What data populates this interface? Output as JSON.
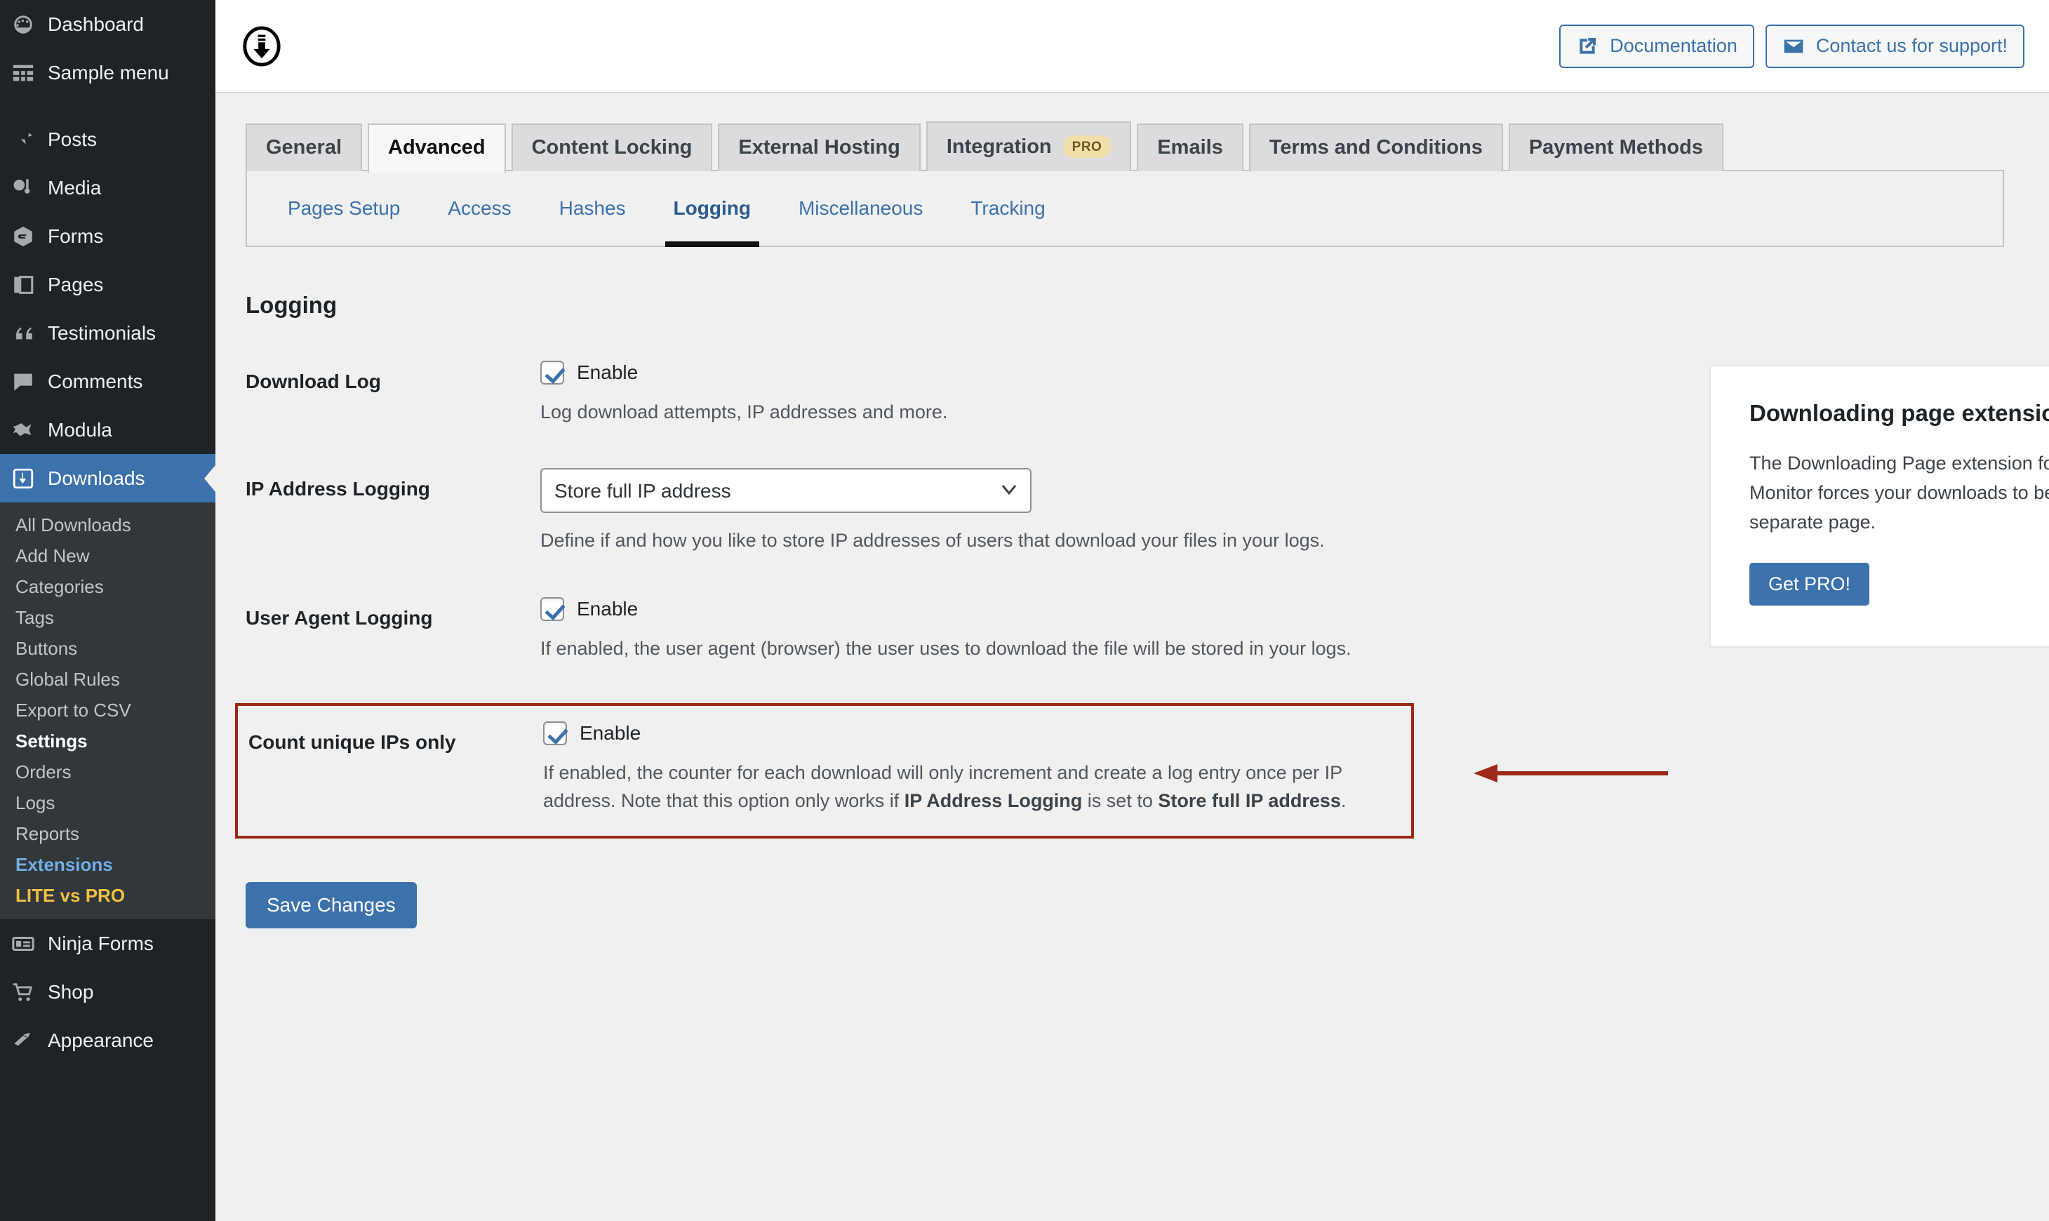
{
  "sidebar": {
    "top_items": [
      {
        "label": "Dashboard",
        "icon": "dashboard-icon"
      },
      {
        "label": "Sample menu",
        "icon": "grid-icon"
      }
    ],
    "main_items": [
      {
        "label": "Posts",
        "icon": "pin-icon"
      },
      {
        "label": "Media",
        "icon": "media-icon"
      },
      {
        "label": "Forms",
        "icon": "forms-icon"
      },
      {
        "label": "Pages",
        "icon": "pages-icon"
      },
      {
        "label": "Testimonials",
        "icon": "quote-icon"
      },
      {
        "label": "Comments",
        "icon": "comment-icon"
      },
      {
        "label": "Modula",
        "icon": "modula-icon"
      }
    ],
    "active_item": {
      "label": "Downloads",
      "icon": "download-circle-icon"
    },
    "submenu": [
      {
        "label": "All Downloads",
        "state": "normal"
      },
      {
        "label": "Add New",
        "state": "normal"
      },
      {
        "label": "Categories",
        "state": "normal"
      },
      {
        "label": "Tags",
        "state": "normal"
      },
      {
        "label": "Buttons",
        "state": "normal"
      },
      {
        "label": "Global Rules",
        "state": "normal"
      },
      {
        "label": "Export to CSV",
        "state": "normal"
      },
      {
        "label": "Settings",
        "state": "current"
      },
      {
        "label": "Orders",
        "state": "normal"
      },
      {
        "label": "Logs",
        "state": "normal"
      },
      {
        "label": "Reports",
        "state": "normal"
      },
      {
        "label": "Extensions",
        "state": "blue"
      },
      {
        "label": "LITE vs PRO",
        "state": "gold"
      }
    ],
    "bottom_items": [
      {
        "label": "Ninja Forms",
        "icon": "ninja-forms-icon"
      },
      {
        "label": "Shop",
        "icon": "cart-icon"
      },
      {
        "label": "Appearance",
        "icon": "brush-icon"
      }
    ]
  },
  "header": {
    "logo_icon": "download-monitor-logo-icon",
    "documentation_label": "Documentation",
    "documentation_icon": "external-link-icon",
    "support_label": "Contact us for support!",
    "support_icon": "envelope-icon"
  },
  "main_tabs": [
    {
      "label": "General",
      "active": false,
      "badge": ""
    },
    {
      "label": "Advanced",
      "active": true,
      "badge": ""
    },
    {
      "label": "Content Locking",
      "active": false,
      "badge": ""
    },
    {
      "label": "External Hosting",
      "active": false,
      "badge": ""
    },
    {
      "label": "Integration",
      "active": false,
      "badge": "PRO"
    },
    {
      "label": "Emails",
      "active": false,
      "badge": ""
    },
    {
      "label": "Terms and Conditions",
      "active": false,
      "badge": ""
    },
    {
      "label": "Payment Methods",
      "active": false,
      "badge": ""
    }
  ],
  "sub_tabs": [
    {
      "label": "Pages Setup",
      "active": false
    },
    {
      "label": "Access",
      "active": false
    },
    {
      "label": "Hashes",
      "active": false
    },
    {
      "label": "Logging",
      "active": true
    },
    {
      "label": "Miscellaneous",
      "active": false
    },
    {
      "label": "Tracking",
      "active": false
    }
  ],
  "form": {
    "section_title": "Logging",
    "download_log": {
      "label": "Download Log",
      "checkbox_label": "Enable",
      "checked": true,
      "description": "Log download attempts, IP addresses and more."
    },
    "ip_logging": {
      "label": "IP Address Logging",
      "selected": "Store full IP address",
      "options": [
        "Store full IP address"
      ],
      "description": "Define if and how you like to store IP addresses of users that download your files in your logs."
    },
    "user_agent_logging": {
      "label": "User Agent Logging",
      "checkbox_label": "Enable",
      "checked": true,
      "description": "If enabled, the user agent (browser) the user uses to download the file will be stored in your logs."
    },
    "count_unique_ips": {
      "label": "Count unique IPs only",
      "checkbox_label": "Enable",
      "checked": true,
      "description_part1": "If enabled, the counter for each download will only increment and create a log entry once per IP address. Note that this option only works if ",
      "description_bold1": "IP Address Logging",
      "description_part2": " is set to ",
      "description_bold2": "Store full IP address",
      "description_part3": "."
    },
    "save_label": "Save Changes"
  },
  "promo": {
    "title": "Downloading page extension",
    "body": "The Downloading Page extension for Download Monitor forces your downloads to be served from a separate page.",
    "button_label": "Get PRO!"
  },
  "annotation": {
    "arrow_color": "#9c2a15",
    "highlight_color": "#9c2a15"
  }
}
